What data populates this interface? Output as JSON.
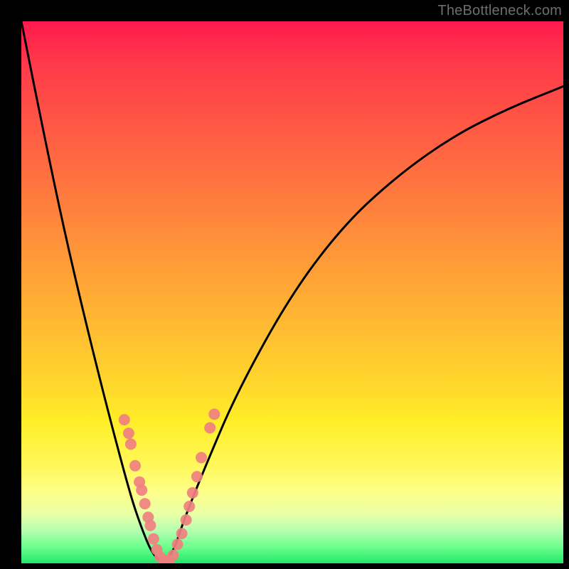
{
  "watermark": "TheBottleneck.com",
  "colors": {
    "frame": "#000000",
    "watermark": "#6e6e6e",
    "curve": "#000000",
    "marker": "#f08080",
    "gradient_stops": [
      "#ff1a4d",
      "#ff3a4a",
      "#ff5a44",
      "#ff7a3e",
      "#ff9a38",
      "#ffba32",
      "#ffd42c",
      "#ffee28",
      "#fff85a",
      "#fdff8a",
      "#e8ffa6",
      "#b4ffb0",
      "#6cff8c",
      "#22e86a"
    ]
  },
  "chart_data": {
    "type": "line",
    "title": "",
    "xlabel": "",
    "ylabel": "",
    "xlim": [
      0,
      100
    ],
    "ylim": [
      0,
      100
    ],
    "grid": false,
    "legend": false,
    "series": [
      {
        "name": "bottleneck-curve",
        "description": "V-shaped curve; value ≈0 near optimum, rises toward 100 away from it. Minimum around x≈26.",
        "x": [
          0,
          4,
          8,
          12,
          16,
          20,
          22,
          24,
          26,
          28,
          30,
          34,
          40,
          50,
          60,
          70,
          80,
          90,
          100
        ],
        "y": [
          100,
          80,
          61,
          44,
          28,
          13,
          7,
          2,
          0,
          2,
          8,
          18,
          32,
          50,
          63,
          72,
          79,
          84,
          88
        ]
      }
    ],
    "markers": {
      "name": "sample-points",
      "description": "Salmon dots clustered along lower portion of both arms of the V.",
      "points": [
        {
          "x": 19.0,
          "y": 26.5
        },
        {
          "x": 19.8,
          "y": 24.0
        },
        {
          "x": 20.2,
          "y": 22.0
        },
        {
          "x": 21.0,
          "y": 18.0
        },
        {
          "x": 21.8,
          "y": 15.0
        },
        {
          "x": 22.2,
          "y": 13.5
        },
        {
          "x": 22.8,
          "y": 11.0
        },
        {
          "x": 23.4,
          "y": 8.5
        },
        {
          "x": 23.8,
          "y": 7.0
        },
        {
          "x": 24.4,
          "y": 4.5
        },
        {
          "x": 25.0,
          "y": 2.5
        },
        {
          "x": 25.6,
          "y": 1.2
        },
        {
          "x": 26.4,
          "y": 0.5
        },
        {
          "x": 27.2,
          "y": 0.5
        },
        {
          "x": 28.0,
          "y": 1.5
        },
        {
          "x": 28.8,
          "y": 3.5
        },
        {
          "x": 29.6,
          "y": 5.5
        },
        {
          "x": 30.4,
          "y": 8.0
        },
        {
          "x": 31.0,
          "y": 10.5
        },
        {
          "x": 31.6,
          "y": 13.0
        },
        {
          "x": 32.4,
          "y": 16.0
        },
        {
          "x": 33.2,
          "y": 19.5
        },
        {
          "x": 34.8,
          "y": 25.0
        },
        {
          "x": 35.6,
          "y": 27.5
        }
      ]
    }
  }
}
